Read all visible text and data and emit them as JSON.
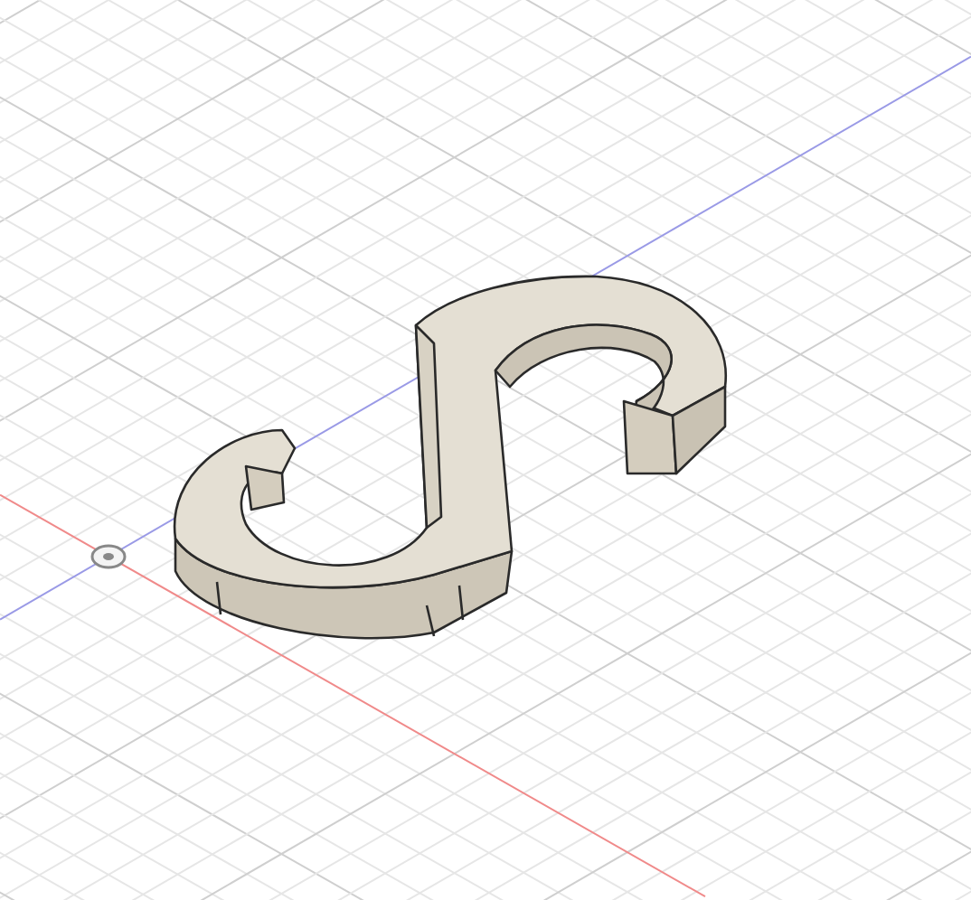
{
  "viewport": {
    "grid": true,
    "axes": true,
    "origin": true,
    "model": {
      "kind": "s-hook"
    }
  }
}
